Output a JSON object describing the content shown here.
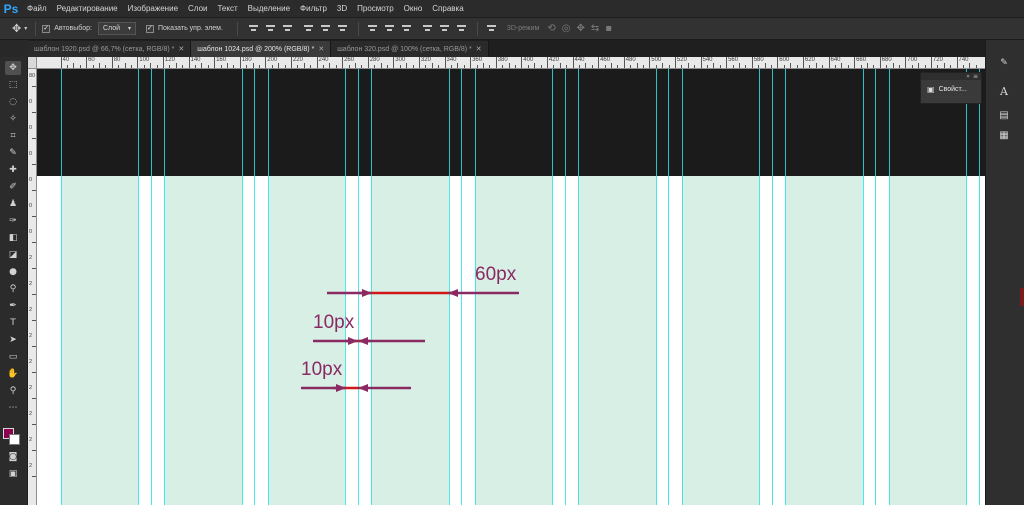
{
  "app": {
    "logo": "Ps"
  },
  "menu": [
    "Файл",
    "Редактирование",
    "Изображение",
    "Слои",
    "Текст",
    "Выделение",
    "Фильтр",
    "3D",
    "Просмотр",
    "Окно",
    "Справка"
  ],
  "options": {
    "autoselect_label": "Автовыбор:",
    "autoselect_checked": true,
    "autoselect_value": "Слой",
    "show_transform_label": "Показать упр. элем.",
    "show_transform_checked": true,
    "mode_3d_label": "3D-режим"
  },
  "tabs": [
    {
      "label": "шаблон 1920.psd @ 66,7% (сетка, RGB/8) *",
      "active": false
    },
    {
      "label": "шаблон 1024.psd @ 200% (RGB/8) *",
      "active": true
    },
    {
      "label": "шаблон 320.psd @ 100% (сетка, RGB/8) *",
      "active": false
    }
  ],
  "ruler": {
    "h_labels": [
      "40",
      "60",
      "80",
      "100",
      "120",
      "140",
      "160",
      "180",
      "200",
      "220",
      "240",
      "260",
      "280",
      "300",
      "320",
      "340",
      "360",
      "380",
      "400",
      "420",
      "440",
      "460",
      "480",
      "500",
      "520",
      "540",
      "560",
      "580",
      "600",
      "620",
      "640",
      "660",
      "680",
      "700",
      "720",
      "740"
    ],
    "v_labels": [
      "80",
      "0",
      "0",
      "0",
      "0",
      "0",
      "0",
      "2",
      "2",
      "2",
      "2",
      "2",
      "2",
      "2",
      "2",
      "2"
    ]
  },
  "tools": [
    "move-tool",
    "marquee-tool",
    "lasso-tool",
    "magic-wand-tool",
    "crop-tool",
    "eyedropper-tool",
    "healing-brush-tool",
    "brush-tool",
    "clone-stamp-tool",
    "history-brush-tool",
    "eraser-tool",
    "gradient-tool",
    "blur-tool",
    "dodge-tool",
    "pen-tool",
    "type-tool",
    "path-selection-tool",
    "rectangle-tool",
    "hand-tool",
    "zoom-tool",
    "more-tools"
  ],
  "colors": {
    "foreground": "#8e0050",
    "background": "#ffffff",
    "column_fill": "#d8efe6",
    "guide": "#2fe0e6",
    "header_band": "#1b1b1b",
    "annotation": "#8a2a63",
    "measure_red": "#d01818"
  },
  "annotations": {
    "gap_label_60": "60px",
    "gap_label_10a": "10px",
    "gap_label_10b": "10px"
  },
  "properties_panel": {
    "label": "Свойст..."
  }
}
